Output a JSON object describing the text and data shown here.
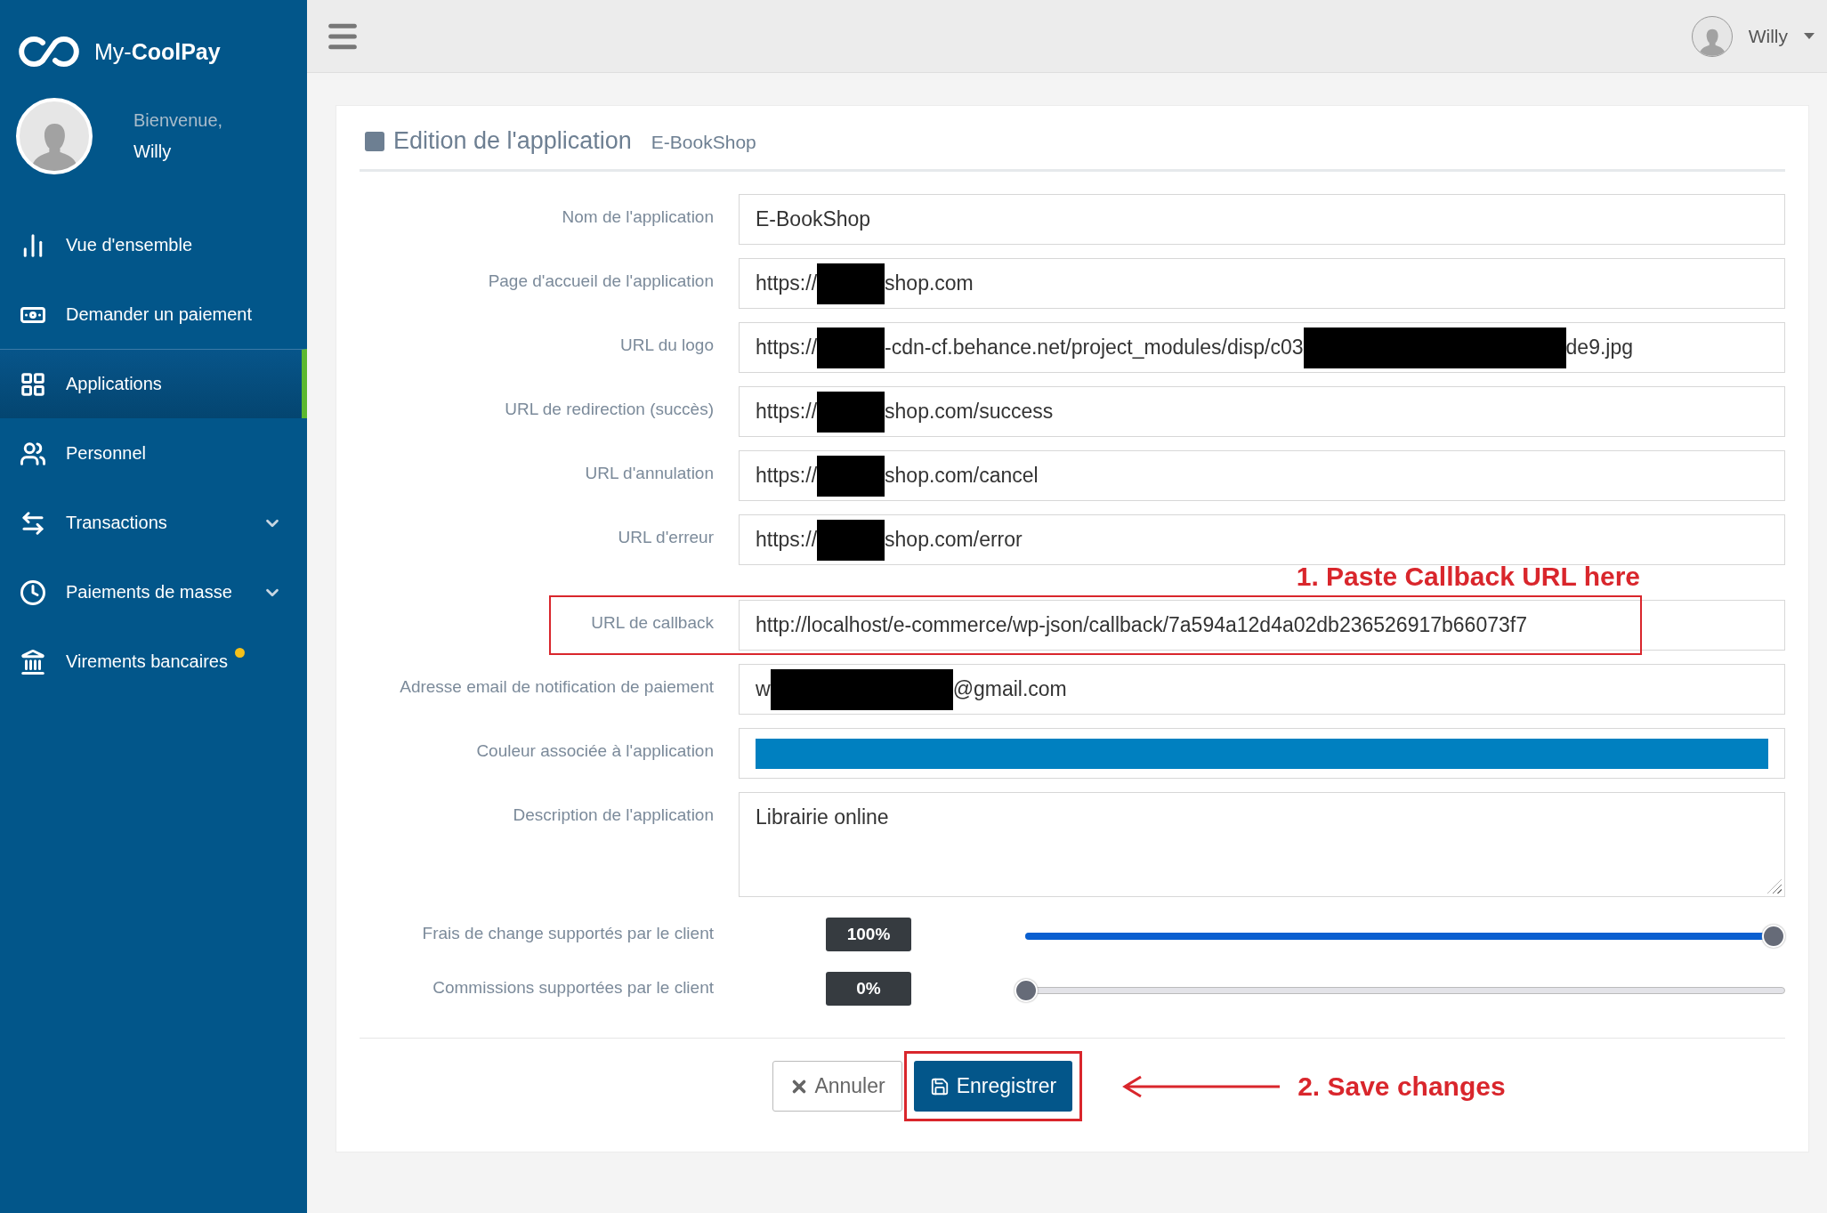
{
  "brand": {
    "logo_text": "My-**CoolPay**"
  },
  "user": {
    "greeting": "Bienvenue,",
    "name": "Willy"
  },
  "sidebar": {
    "items": [
      {
        "label": "Vue d'ensemble",
        "selected": false,
        "expandable": false,
        "notification": false
      },
      {
        "label": "Demander un paiement",
        "selected": false,
        "expandable": false,
        "notification": false
      },
      {
        "label": "Applications",
        "selected": true,
        "expandable": false,
        "notification": false
      },
      {
        "label": "Personnel",
        "selected": false,
        "expandable": false,
        "notification": false
      },
      {
        "label": "Transactions",
        "selected": false,
        "expandable": true,
        "notification": false
      },
      {
        "label": "Paiements de masse",
        "selected": false,
        "expandable": true,
        "notification": false
      },
      {
        "label": "Virements bancaires",
        "selected": false,
        "expandable": false,
        "notification": true
      }
    ]
  },
  "topbar": {
    "user_name": "Willy"
  },
  "panel": {
    "title": "Edition de l'application",
    "subtitle": "E-BookShop"
  },
  "fields": [
    {
      "kind": "text",
      "label": "Nom de l'application",
      "value_parts": [
        "E-BookShop"
      ]
    },
    {
      "kind": "text",
      "label": "Page d'accueil de l'application",
      "value_parts": [
        "https://",
        "shop.com"
      ]
    },
    {
      "kind": "text",
      "label": "URL du logo",
      "value_parts": [
        "https://",
        "-cdn-cf.behance.net/project_modules/disp/c03",
        "de9.jpg"
      ]
    },
    {
      "kind": "text",
      "label": "URL de redirection (succès)",
      "value_parts": [
        "https://",
        "shop.com/success"
      ]
    },
    {
      "kind": "text",
      "label": "URL d'annulation",
      "value_parts": [
        "https://",
        "shop.com/cancel"
      ]
    },
    {
      "kind": "text",
      "label": "URL d'erreur",
      "value_parts": [
        "https://",
        "shop.com/error"
      ]
    },
    {
      "kind": "text",
      "label": "URL de callback",
      "value_parts": [
        "http://localhost/e-commerce/wp-json/callback/7a594a12d4a02db236526917b66073f7"
      ],
      "annotation": "1. Paste Callback URL here"
    },
    {
      "kind": "text",
      "label": "Adresse email de notification de paiement",
      "value_parts": [
        "w",
        "@gmail.com"
      ]
    },
    {
      "kind": "color",
      "label": "Couleur associée à l'application",
      "color": "#0080c0"
    },
    {
      "kind": "textarea",
      "label": "Description de l'application",
      "value_parts": [
        "Librairie online"
      ]
    },
    {
      "kind": "slider",
      "label": "Frais de change supportés par le client",
      "reading": "100%",
      "level": 1
    },
    {
      "kind": "slider",
      "label": "Commissions supportées par le client",
      "reading": "0%",
      "level": 0
    }
  ],
  "buttons": {
    "cancel": "Annuler",
    "save": "Enregistrer",
    "save_annotation": "2. Save changes"
  }
}
